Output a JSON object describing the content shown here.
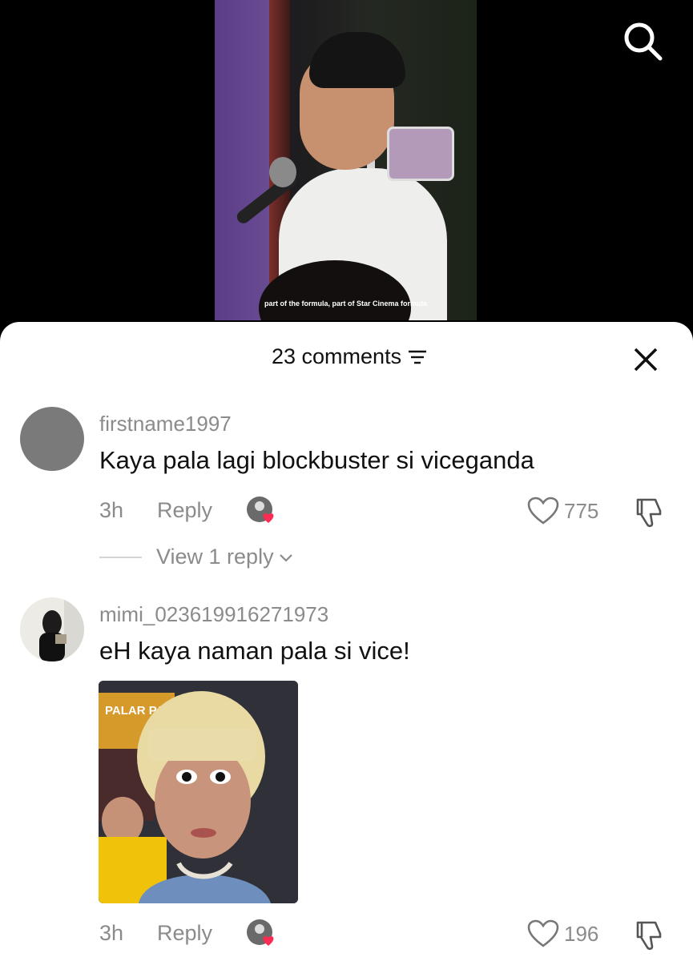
{
  "video": {
    "caption": "part of the formula, part of Star Cinema formula"
  },
  "icons": {
    "search": "search-icon",
    "filter": "filter-icon",
    "close": "close-icon",
    "heart": "heart-icon",
    "dislike": "dislike-icon",
    "chevron": "chevron-down-icon"
  },
  "comments_panel": {
    "count_label": "23 comments",
    "comments": [
      {
        "username": "firstname1997",
        "text": "Kaya pala lagi blockbuster si viceganda",
        "time": "3h",
        "reply_label": "Reply",
        "likes": "775",
        "view_replies": "View 1 reply"
      },
      {
        "username": "mimi_023619916271973",
        "text": "eH kaya naman pala si vice!",
        "time": "3h",
        "reply_label": "Reply",
        "likes": "196",
        "image_sign_text": "PALAR PANG-"
      }
    ]
  },
  "colors": {
    "accent_heart": "#fe2c55",
    "muted_text": "#8b8b8b"
  }
}
